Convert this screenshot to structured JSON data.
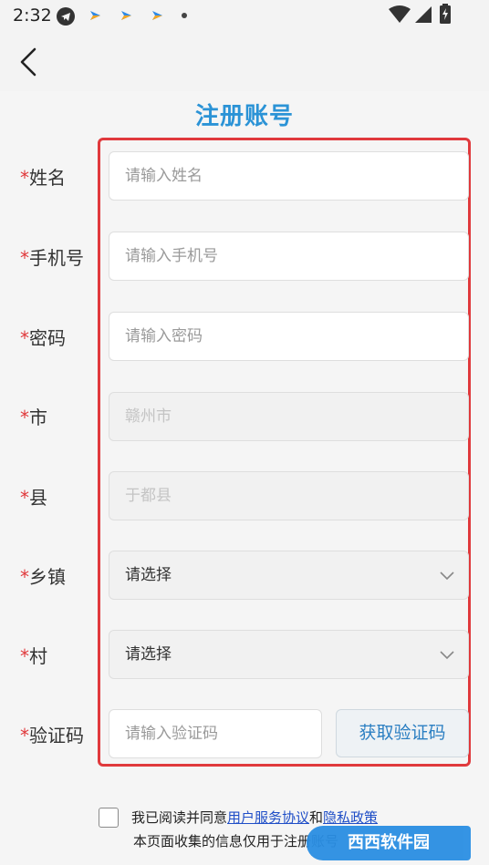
{
  "status_bar": {
    "time": "2:32"
  },
  "page": {
    "title": "注册账号"
  },
  "form": {
    "required_mark": "*",
    "fields": [
      {
        "label": "姓名",
        "placeholder": "请输入姓名"
      },
      {
        "label": "手机号",
        "placeholder": "请输入手机号"
      },
      {
        "label": "密码",
        "placeholder": "请输入密码"
      },
      {
        "label": "市",
        "value": "赣州市"
      },
      {
        "label": "县",
        "value": "于都县"
      },
      {
        "label": "乡镇",
        "value": "请选择"
      },
      {
        "label": "村",
        "value": "请选择"
      },
      {
        "label": "验证码",
        "placeholder": "请输入验证码"
      }
    ],
    "get_code_button": "获取验证码",
    "highlight_color": "#e0393c"
  },
  "agreement": {
    "prefix": "我已阅读并同意",
    "user_agreement": "用户服务协议",
    "and": "和",
    "privacy_policy": "隐私政策",
    "note": "本页面收集的信息仅用于注册账号"
  },
  "watermark": {
    "text": "西西软件园"
  },
  "colors": {
    "accent": "#2b93d6",
    "link": "#1f4ec7"
  }
}
